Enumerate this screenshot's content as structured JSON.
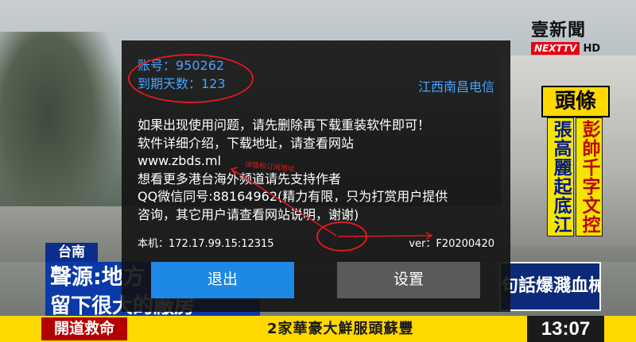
{
  "tv": {
    "logo_cn": "壹新聞",
    "logo_brand": "NEXTTV",
    "logo_hd": "HD",
    "headline_tag": "頭條",
    "headline_col1": "張高麗起底江派人馬",
    "headline_col2": "彭帥千字文控捋上床",
    "location": "台南",
    "subtitle1": "聲源:地方",
    "subtitle2": "留下很大的廠房",
    "right_bar": "句話爆濺血械",
    "ticker_tag": "開道救命",
    "ticker_text": "2家華豪大鮮服頭蘇豐",
    "clock": "13:07"
  },
  "dialog": {
    "account_line": "账号：950262",
    "expiry_line": "到期天数：123",
    "carrier": "江西南昌电信",
    "messages": [
      "如果出现使用问题，请先删除再下载重装软件即可！",
      "软件详细介绍，下载地址，请查看网站",
      "www.zbds.ml",
      "想看更多港台海外频道请先支持作者",
      "QQ微信同号:88164962(精力有限，只为打赏用户提供",
      "咨询，其它用户请查看网站说明，谢谢)"
    ],
    "local_info": "本机：172.17.99.15:12315",
    "version": "ver：F20200420",
    "annotation_label": "详情和订阅地址",
    "exit_label": "退出",
    "settings_label": "设置"
  },
  "colors": {
    "accent_blue": "#1e88e5",
    "text_blue": "#4aa3ff",
    "annotation_red": "#e3181e"
  }
}
